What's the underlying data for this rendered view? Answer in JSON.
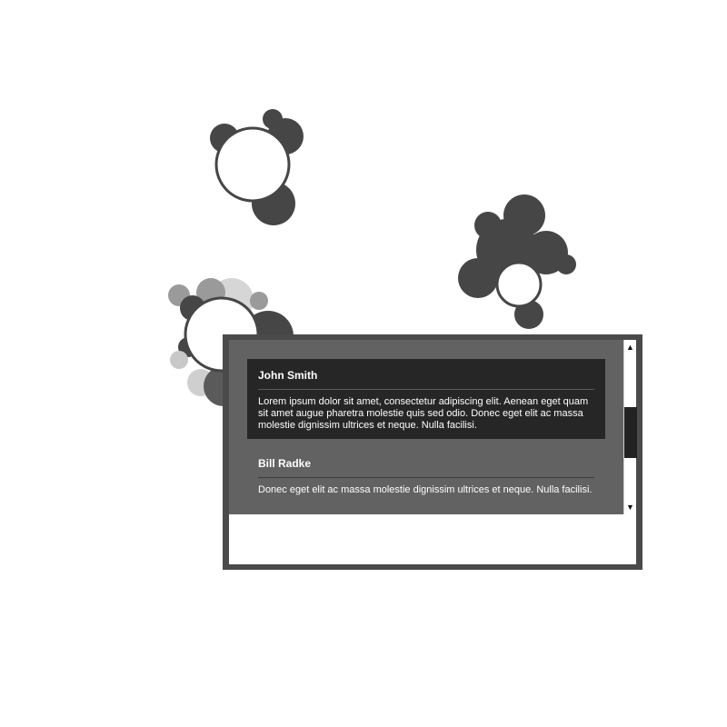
{
  "colors": {
    "bubble": "#464646",
    "bubble_light": "#9a9a9a",
    "panel_frame": "#4a4a4a",
    "list_bg": "#626262",
    "selected_bg": "#262626"
  },
  "list": {
    "items": [
      {
        "name": "John Smith",
        "text": "Lorem ipsum dolor sit amet, consectetur adipiscing elit. Aenean eget quam sit amet augue pharetra molestie quis sed odio. Donec eget elit ac massa molestie dignissim ultrices et neque. Nulla facilisi.",
        "selected": true
      },
      {
        "name": "Bill Radke",
        "text": "Donec eget elit ac massa molestie dignissim ultrices et neque. Nulla facilisi.",
        "selected": false
      }
    ]
  },
  "scrollbar": {
    "up_icon": "▲",
    "down_icon": "▼",
    "position": 0.4
  }
}
